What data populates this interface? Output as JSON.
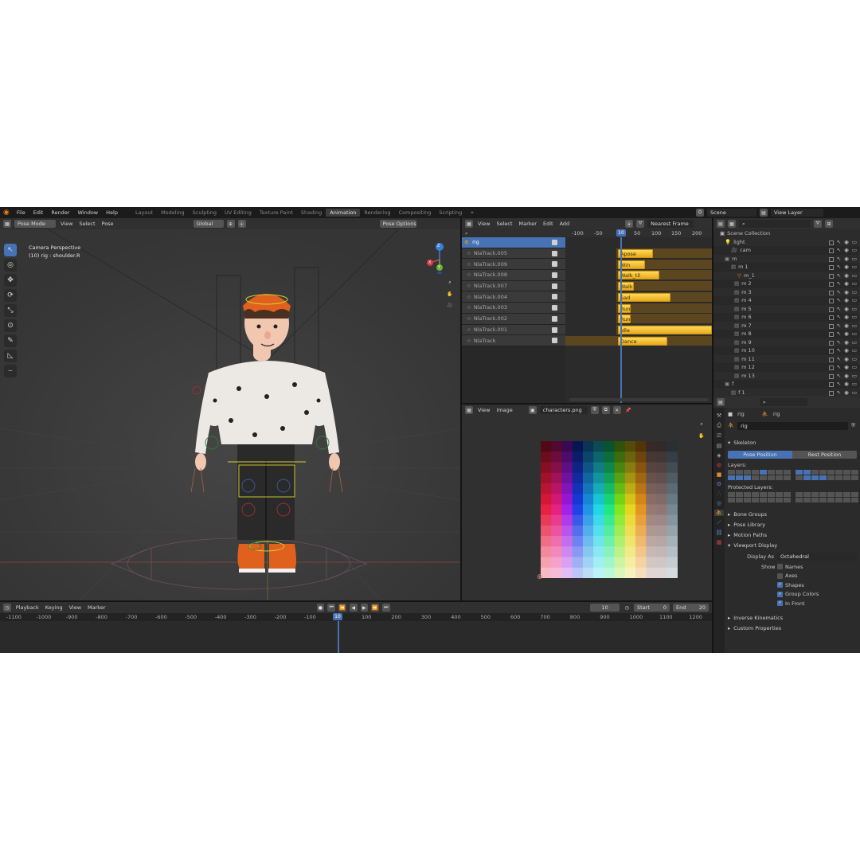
{
  "menus": [
    "File",
    "Edit",
    "Render",
    "Window",
    "Help"
  ],
  "workspaces": [
    "Layout",
    "Modeling",
    "Sculpting",
    "UV Editing",
    "Texture Paint",
    "Shading",
    "Animation",
    "Rendering",
    "Compositing",
    "Scripting"
  ],
  "active_workspace": "Animation",
  "add_workspace": "+",
  "scene": {
    "name": "Scene",
    "view_layer": "View Layer"
  },
  "viewport": {
    "mode": "Pose Mode",
    "menu": [
      "View",
      "Select",
      "Pose"
    ],
    "transform": "Global",
    "options": "Pose Options",
    "overlay_title": "Camera Perspective",
    "overlay_sub": "(10) rig : shoulder.R",
    "gizmo_axes": [
      "Z",
      "X",
      "Y"
    ]
  },
  "nla": {
    "menu": [
      "View",
      "Select",
      "Marker",
      "Edit",
      "Add"
    ],
    "snap": "Nearest Frame",
    "ruler": [
      "-100",
      "-50",
      "10",
      "50",
      "100",
      "150",
      "200"
    ],
    "current_frame": "10",
    "object": "rig",
    "tracks": [
      {
        "name": "NlaTrack.005",
        "strip": "Apose"
      },
      {
        "name": "NlaTrack.009",
        "strip": "Win"
      },
      {
        "name": "NlaTrack.008",
        "strip": "Walk_til"
      },
      {
        "name": "NlaTrack.007",
        "strip": "Walk"
      },
      {
        "name": "NlaTrack.004",
        "strip": "Sad"
      },
      {
        "name": "NlaTrack.003",
        "strip": "Run"
      },
      {
        "name": "NlaTrack.002",
        "strip": "Run"
      },
      {
        "name": "NlaTrack.001",
        "strip": "Idle"
      },
      {
        "name": "NlaTrack",
        "strip": "Dance"
      }
    ]
  },
  "image_editor": {
    "menu": [
      "View",
      "Image"
    ],
    "image_name": "characters.png"
  },
  "outliner": {
    "root": "Scene Collection",
    "items": [
      "light",
      "cam",
      "m",
      "m 1",
      "m_1",
      "m 2",
      "m 3",
      "m 4",
      "m 5",
      "m 6",
      "m 7",
      "m 8",
      "m 9",
      "m 10",
      "m 11",
      "m 12",
      "m 13",
      "f",
      "f 1"
    ]
  },
  "properties": {
    "object": "rig",
    "armature": "rig",
    "data_name": "rig",
    "skeleton": "Skeleton",
    "pose_position": "Pose Position",
    "rest_position": "Rest Position",
    "layers": "Layers:",
    "protected_layers": "Protected Layers:",
    "sections": [
      "Bone Groups",
      "Pose Library",
      "Motion Paths"
    ],
    "viewport_display": "Viewport Display",
    "display_as_label": "Display As",
    "display_as": "Octahedral",
    "show_label": "Show",
    "show_options": [
      {
        "label": "Names",
        "checked": false
      },
      {
        "label": "Axes",
        "checked": false
      },
      {
        "label": "Shapes",
        "checked": true
      },
      {
        "label": "Group Colors",
        "checked": true
      },
      {
        "label": "In Front",
        "checked": true
      }
    ],
    "bottom_sections": [
      "Inverse Kinematics",
      "Custom Properties"
    ]
  },
  "timeline": {
    "menu": [
      "Playback",
      "Keying",
      "View",
      "Marker"
    ],
    "current_frame": "10",
    "start_label": "Start",
    "start": "0",
    "end_label": "End",
    "end": "20",
    "ruler": [
      "-1100",
      "-1000",
      "-900",
      "-800",
      "-700",
      "-600",
      "-500",
      "-400",
      "-300",
      "-200",
      "-100",
      "10",
      "100",
      "200",
      "300",
      "400",
      "500",
      "600",
      "700",
      "800",
      "900",
      "1000",
      "1100",
      "1200"
    ]
  },
  "colors": {
    "accent": "#4772b3",
    "strip": "#f2c232",
    "shirt": "#ece9e4",
    "beanie": "#e0601e",
    "pants": "#2a2a2a"
  }
}
